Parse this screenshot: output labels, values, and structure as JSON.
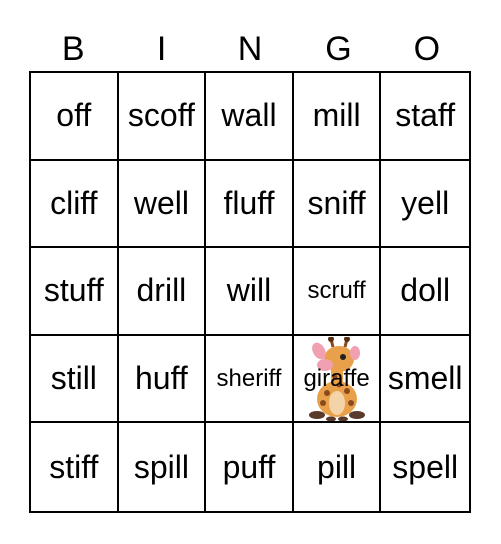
{
  "header": [
    "B",
    "I",
    "N",
    "G",
    "O"
  ],
  "cells": [
    {
      "text": "off"
    },
    {
      "text": "scoff"
    },
    {
      "text": "wall"
    },
    {
      "text": "mill"
    },
    {
      "text": "staff"
    },
    {
      "text": "cliff"
    },
    {
      "text": "well"
    },
    {
      "text": "fluff"
    },
    {
      "text": "sniff"
    },
    {
      "text": "yell"
    },
    {
      "text": "stuff"
    },
    {
      "text": "drill"
    },
    {
      "text": "will"
    },
    {
      "text": "scruff",
      "small": true
    },
    {
      "text": "doll"
    },
    {
      "text": "still"
    },
    {
      "text": "huff"
    },
    {
      "text": "sheriff",
      "small": true
    },
    {
      "text": "giraffe",
      "free": true,
      "icon": "giraffe-icon"
    },
    {
      "text": "smell"
    },
    {
      "text": "stiff"
    },
    {
      "text": "spill"
    },
    {
      "text": "puff"
    },
    {
      "text": "pill"
    },
    {
      "text": "spell"
    }
  ],
  "colors": {
    "giraffe_body": "#e8a04a",
    "giraffe_spots": "#8b4a1e",
    "giraffe_ear": "#f0a0b0"
  }
}
